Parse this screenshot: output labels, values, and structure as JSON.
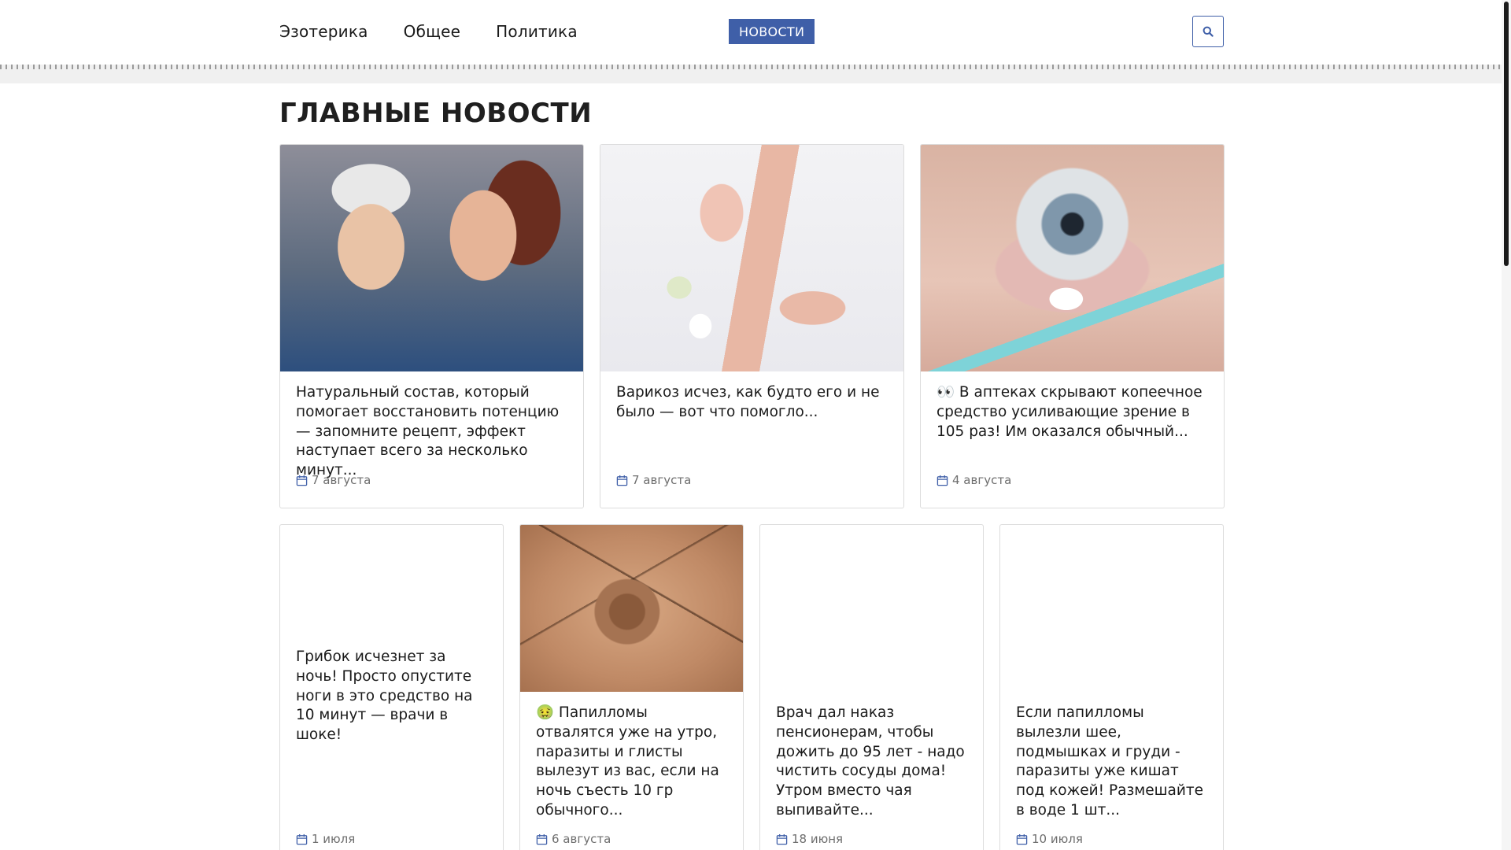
{
  "nav": {
    "items": [
      "Эзотерика",
      "Общее",
      "Политика"
    ],
    "badge": "НОВОСТИ"
  },
  "search": {
    "icon": "search-icon"
  },
  "section": {
    "title": "ГЛАВНЫЕ НОВОСТИ"
  },
  "top_cards": [
    {
      "image": "elderly-couple-photo",
      "title": "Натуральный состав, который помогает восстановить потенцию — запомните рецепт, эффект наступает всего за несколько минут...",
      "date": "7 августа"
    },
    {
      "image": "leg-cream-photo",
      "title": "Варикоз исчез, как будто его и не было — вот что помогло...",
      "date": "7 августа"
    },
    {
      "image": "eye-closeup-photo",
      "title": "👀 В аптеках скрывают копеечное средство усиливающие зрение в 105 раз! Им оказался обычный...",
      "date": "4 августа"
    }
  ],
  "bottom_cards": [
    {
      "image": "",
      "title": "Грибок исчезнет за ночь! Просто опустите ноги в это средство на 10 минут — врачи в шоке!",
      "date": "1 июля"
    },
    {
      "image": "skin-papilloma-photo",
      "title": "🤢 Папилломы отвалятся уже на утро, паразиты и глисты вылезут из вас, если на ночь съесть 10 гр обычного...",
      "date": "6 августа"
    },
    {
      "image": "",
      "title": "Врач дал наказ пенсионерам, чтобы дожить до 95 лет - надо чистить сосуды дома! Утром вместо чая выпивайте...",
      "date": "18 июня"
    },
    {
      "image": "",
      "title": "Если папилломы вылезли шее, подмышках и груди - паразиты уже кишат под кожей! Размешайте в воде 1 шт...",
      "date": "10 июля"
    }
  ],
  "colors": {
    "accent": "#3f5fa8",
    "text": "#1a1a1a",
    "muted": "#6e6e6e",
    "border": "#dcdcdc"
  }
}
